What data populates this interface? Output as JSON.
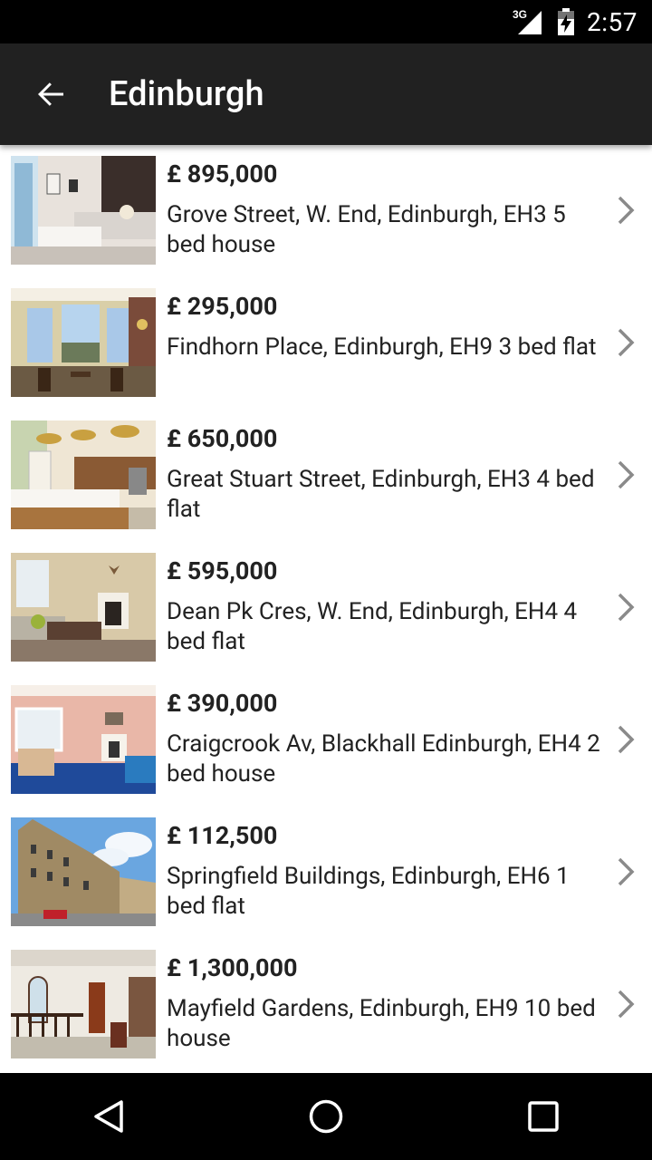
{
  "status_bar": {
    "network": "3G",
    "time": "2:57"
  },
  "app_bar": {
    "title": "Edinburgh"
  },
  "listings": [
    {
      "price": "£ 895,000",
      "description": "Grove Street, W. End, Edinburgh, EH3 5 bed house",
      "photo": "interior-living-dining"
    },
    {
      "price": "£ 295,000",
      "description": "Findhorn Place, Edinburgh, EH9 3 bed flat",
      "photo": "bay-window-room"
    },
    {
      "price": "£ 650,000",
      "description": "Great Stuart Street, Edinburgh, EH3 4 bed flat",
      "photo": "kitchen"
    },
    {
      "price": "£ 595,000",
      "description": "Dean Pk Cres, W. End, Edinburgh, EH4 4 bed flat",
      "photo": "lounge-with-fireplace"
    },
    {
      "price": "£ 390,000",
      "description": "Craigcrook Av, Blackhall Edinburgh, EH4 2 bed house",
      "photo": "lounge-blue-carpet"
    },
    {
      "price": "£ 112,500",
      "description": "Springfield Buildings, Edinburgh, EH6 1 bed flat",
      "photo": "tenement-exterior"
    },
    {
      "price": "£ 1,300,000",
      "description": "Mayfield Gardens, Edinburgh, EH9 10 bed house",
      "photo": "hallway-landing"
    }
  ]
}
